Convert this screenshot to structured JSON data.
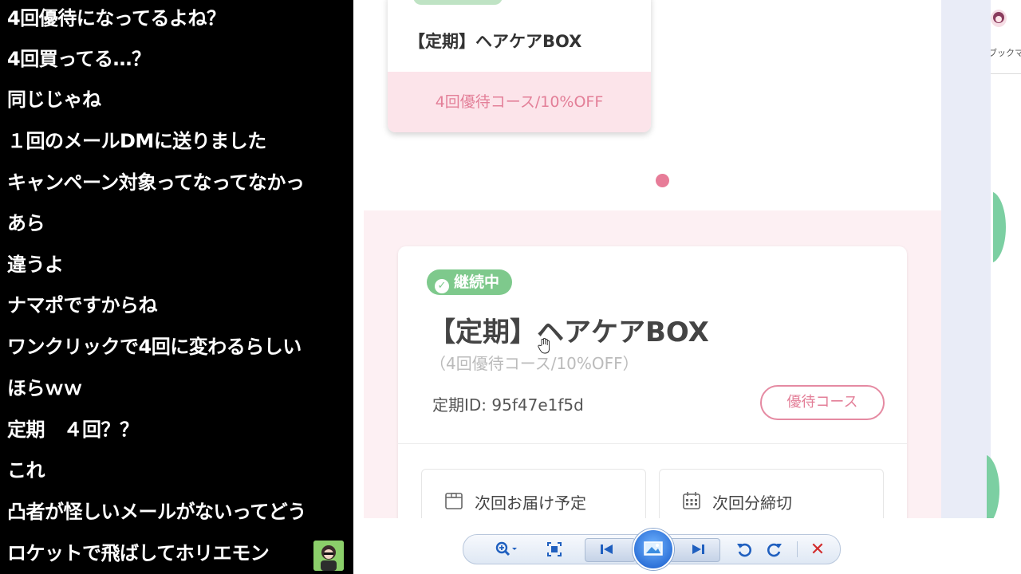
{
  "comments": [
    "4回優待になってるよね？",
    "4回買ってる…？",
    "同じじゃね",
    "１回のメールDMに送りました",
    "キャンペーン対象ってなってなかっ",
    "あら",
    "違うよ",
    "ナマポですからね",
    "ワンクリックで4回に変わるらしい",
    "ほらｗｗ",
    "定期　４回？？",
    "これ",
    "凸者が怪しいメールがないってどう",
    "ロケットで飛ばしてホリエモン"
  ],
  "browser_edge": {
    "bookmark_label": "ブックマ"
  },
  "top_card": {
    "title": "【定期】ヘアケアBOX",
    "offer": "4回優待コース/10%OFF"
  },
  "subscription_card": {
    "status": "継続中",
    "title": "【定期】ヘアケアBOX",
    "course": "（4回優待コース/10%OFF）",
    "subscription_id": "定期ID: 95f47e1f5d",
    "perk_button": "優待コース",
    "next_delivery_label": "次回お届け予定",
    "next_deadline_label": "次回分締切"
  },
  "colors": {
    "pink_accent": "#e37f98",
    "status_green": "#7ec98c",
    "section_bg": "#fdf0f3"
  },
  "toolbar_icons": [
    "zoom-icon",
    "actual-size-icon",
    "previous-icon",
    "slideshow-icon",
    "next-icon",
    "rotate-left-icon",
    "rotate-right-icon",
    "delete-icon"
  ]
}
